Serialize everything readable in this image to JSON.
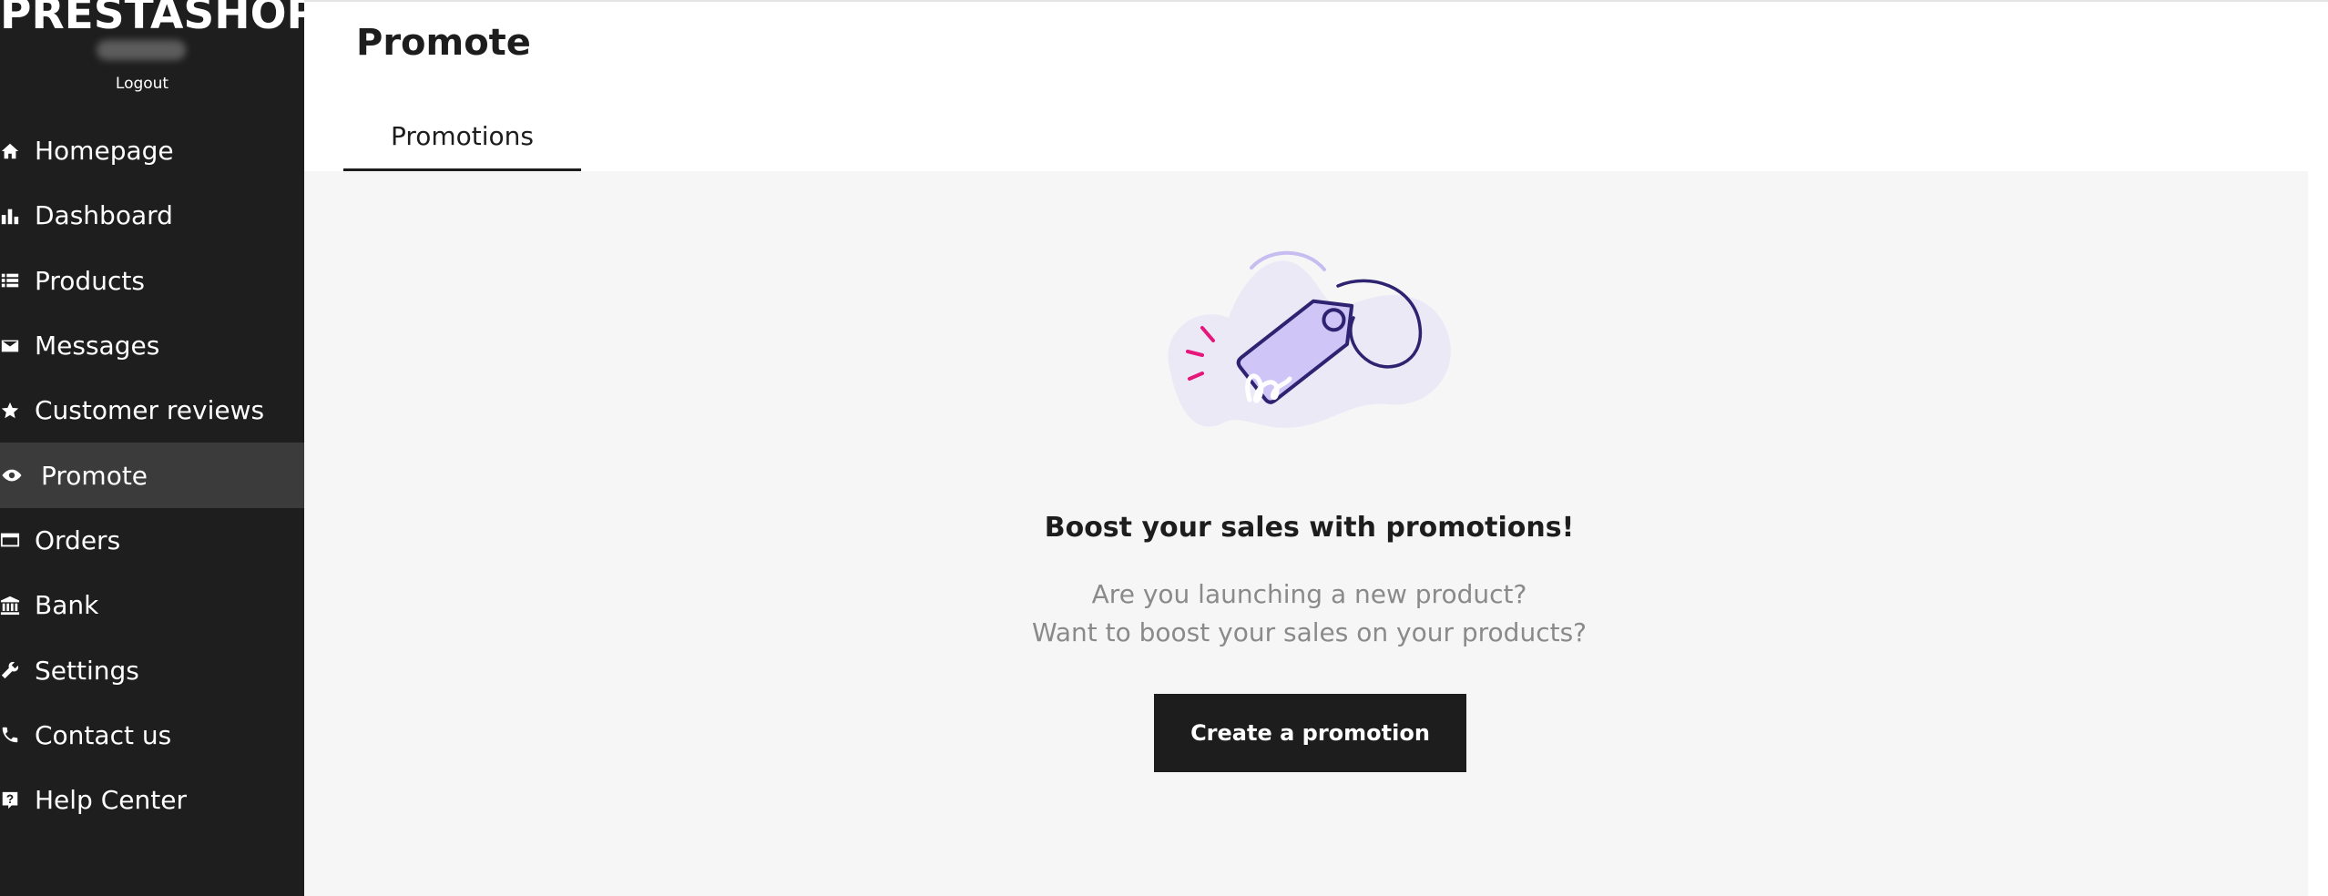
{
  "sidebar": {
    "logo": "PRESTASHOP",
    "logout_label": "Logout",
    "items": [
      {
        "label": "Homepage",
        "icon": "home-icon"
      },
      {
        "label": "Dashboard",
        "icon": "bar-chart-icon"
      },
      {
        "label": "Products",
        "icon": "list-icon"
      },
      {
        "label": "Messages",
        "icon": "envelope-icon"
      },
      {
        "label": "Customer reviews",
        "icon": "star-icon"
      },
      {
        "label": "Promote",
        "icon": "eye-icon",
        "active": true
      },
      {
        "label": "Orders",
        "icon": "credit-card-icon"
      },
      {
        "label": "Bank",
        "icon": "bank-icon"
      },
      {
        "label": "Settings",
        "icon": "wrench-icon"
      },
      {
        "label": "Contact us",
        "icon": "phone-icon"
      },
      {
        "label": "Help Center",
        "icon": "help-icon"
      }
    ]
  },
  "main": {
    "title": "Promote",
    "tabs": [
      {
        "label": "Promotions",
        "active": true
      }
    ],
    "empty_state": {
      "illustration": "price-tag-illustration",
      "heading": "Boost your sales with promotions!",
      "line1": "Are you launching a new product?",
      "line2": "Want to boost your sales on your products?",
      "button_label": "Create a promotion"
    }
  },
  "colors": {
    "sidebar_bg": "#1e1e1e",
    "sidebar_active_bg": "#3b3b3b",
    "content_bg": "#f6f6f6",
    "text_dark": "#1d1d1d",
    "text_muted": "#8a8a8a",
    "tag_fill": "#cfc5f7",
    "tag_stroke": "#2e2370",
    "spark": "#e6177a"
  }
}
